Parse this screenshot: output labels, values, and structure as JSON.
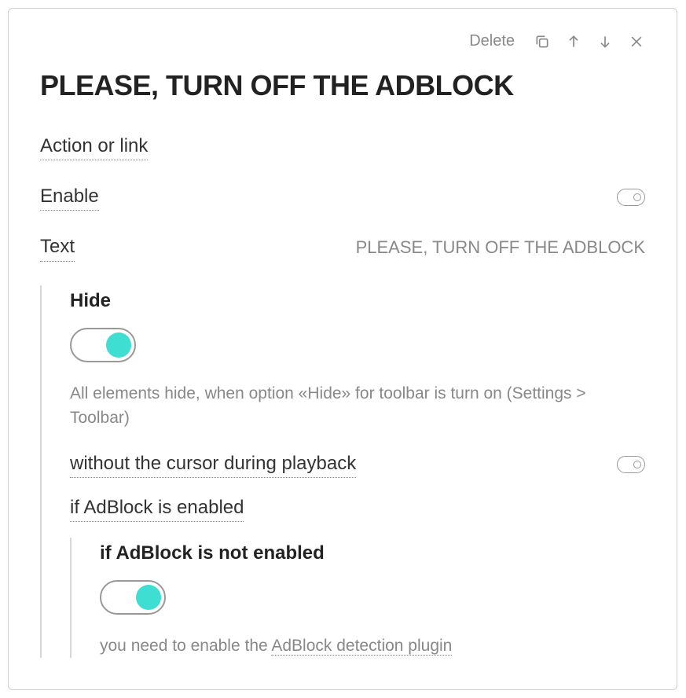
{
  "toolbar": {
    "delete_label": "Delete"
  },
  "title": "PLEASE, TURN OFF THE ADBLOCK",
  "rows": {
    "action_link": "Action or link",
    "enable": "Enable",
    "text_label": "Text",
    "text_value": "PLEASE, TURN OFF THE ADBLOCK"
  },
  "hide_section": {
    "heading": "Hide",
    "description": "All elements hide, when option «Hide» for toolbar is turn on (Settings > Toolbar)",
    "without_cursor": "without the cursor during playback",
    "if_adblock": "if AdBlock is enabled"
  },
  "adblock_not_section": {
    "heading": "if AdBlock is not enabled",
    "description_prefix": "you need to enable the ",
    "link": "AdBlock detection plugin"
  }
}
